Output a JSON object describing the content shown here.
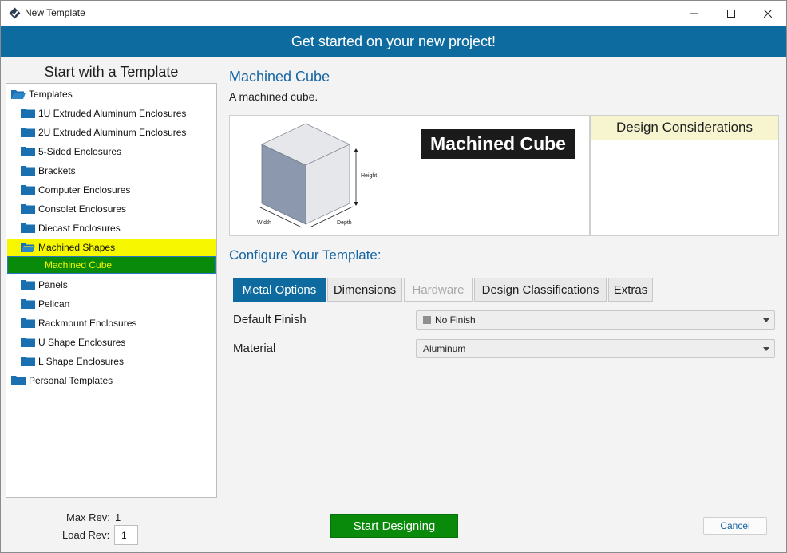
{
  "window": {
    "title": "New Template"
  },
  "banner": {
    "text": "Get started on your new project!"
  },
  "left_panel": {
    "title": "Start with a Template",
    "tree": [
      {
        "label": "Templates",
        "icon": "folder-open-icon"
      },
      {
        "label": "1U Extruded Aluminum Enclosures",
        "icon": "folder-icon"
      },
      {
        "label": "2U Extruded Aluminum Enclosures",
        "icon": "folder-icon"
      },
      {
        "label": "5-Sided Enclosures",
        "icon": "folder-icon"
      },
      {
        "label": "Brackets",
        "icon": "folder-icon"
      },
      {
        "label": "Computer Enclosures",
        "icon": "folder-icon"
      },
      {
        "label": "Consolet Enclosures",
        "icon": "folder-icon"
      },
      {
        "label": "Diecast Enclosures",
        "icon": "folder-icon"
      },
      {
        "label": "Machined Shapes",
        "icon": "folder-open-icon"
      },
      {
        "label": "Machined Cube",
        "icon": "none"
      },
      {
        "label": "Panels",
        "icon": "folder-icon"
      },
      {
        "label": "Pelican",
        "icon": "folder-icon"
      },
      {
        "label": "Rackmount Enclosures",
        "icon": "folder-icon"
      },
      {
        "label": "U Shape Enclosures",
        "icon": "folder-icon"
      },
      {
        "label": "L Shape Enclosures",
        "icon": "folder-icon"
      },
      {
        "label": "Personal Templates",
        "icon": "folder-icon"
      }
    ],
    "max_rev_label": "Max Rev:",
    "max_rev_value": "1",
    "load_rev_label": "Load Rev:",
    "load_rev_value": "1"
  },
  "template": {
    "name": "Machined Cube",
    "description": "A machined cube.",
    "preview_badge": "Machined Cube",
    "dimension_labels": {
      "height": "Height",
      "width": "Width",
      "depth": "Depth"
    }
  },
  "considerations": {
    "title": "Design Considerations"
  },
  "configure": {
    "title": "Configure Your Template:",
    "tabs": [
      {
        "label": "Metal Options",
        "state": "active"
      },
      {
        "label": "Dimensions",
        "state": "normal"
      },
      {
        "label": "Hardware",
        "state": "disabled"
      },
      {
        "label": "Design Classifications",
        "state": "normal"
      },
      {
        "label": "Extras",
        "state": "normal"
      }
    ],
    "fields": [
      {
        "label": "Default Finish",
        "value": "No Finish"
      },
      {
        "label": "Material",
        "value": "Aluminum"
      }
    ]
  },
  "actions": {
    "start": "Start Designing",
    "cancel": "Cancel"
  },
  "colors": {
    "accent": "#0e6b9f",
    "selected_bg": "#0a8a0a",
    "selected_text": "#f7f700",
    "parent_highlight": "#f7f700",
    "heading_blue": "#1565a3"
  }
}
